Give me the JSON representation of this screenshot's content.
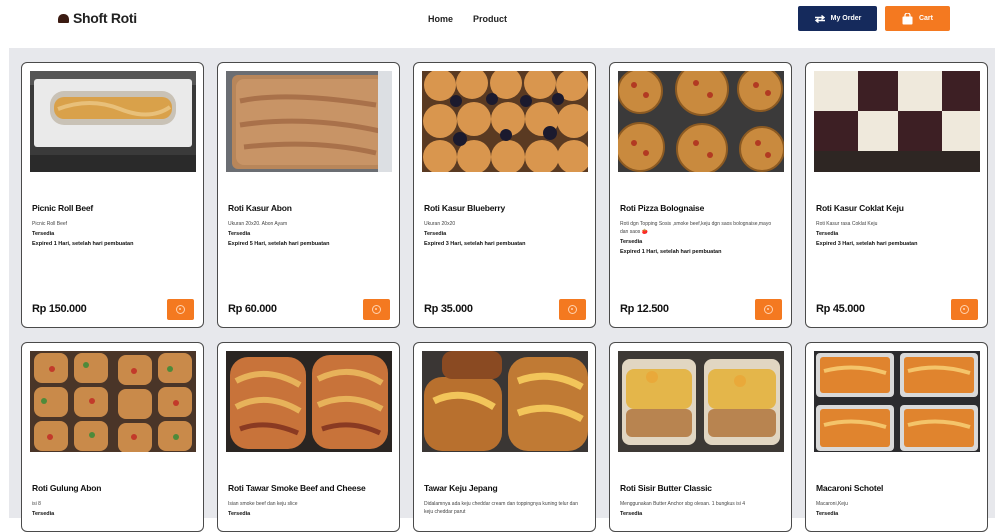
{
  "brand": {
    "name": "Shoft Roti",
    "icon": "bread-icon"
  },
  "nav": {
    "links": [
      "Home",
      "Product"
    ]
  },
  "actions": {
    "order_label": "My Order",
    "cart_label": "Cart"
  },
  "colors": {
    "primary": "#152a5c",
    "accent": "#f47920",
    "background": "#e7e8ec"
  },
  "products": [
    {
      "name": "Picnic Roll Beef",
      "desc": "Picnic Roll Beef",
      "status": "Tersedia",
      "expiry": "Expired 1 Hari, setelah hari pembuatan",
      "price": "Rp 150.000"
    },
    {
      "name": "Roti Kasur Abon",
      "desc": "Ukuran 20x20. Abon Ayam",
      "status": "Tersedia",
      "expiry": "Expired 5 Hari, setelah hari pembuatan",
      "price": "Rp 60.000"
    },
    {
      "name": "Roti Kasur Blueberry",
      "desc": "Ukuran 20x20",
      "status": "Tersedia",
      "expiry": "Expired 3 Hari, setelah hari pembuatan",
      "price": "Rp 35.000"
    },
    {
      "name": "Roti Pizza Bolognaise",
      "desc": "Roti dgn Topping Sosis ,smoke beef,keju dgn saos bolognaise,mayo dan saos 🍅",
      "status": "Tersedia",
      "expiry": "Expired 1 Hari, setelah hari pembuatan",
      "price": "Rp 12.500"
    },
    {
      "name": "Roti Kasur Coklat Keju",
      "desc": "Roti Kasur rasa Coklat Keju",
      "status": "Tersedia",
      "expiry": "Expired 3 Hari, setelah hari pembuatan",
      "price": "Rp 45.000"
    },
    {
      "name": "Roti Gulung Abon",
      "desc": "isi 8",
      "status": "Tersedia",
      "expiry": "",
      "price": ""
    },
    {
      "name": "Roti Tawar Smoke Beef and Cheese",
      "desc": "Isian smoke beef dan keju slice",
      "status": "Tersedia",
      "expiry": "",
      "price": ""
    },
    {
      "name": "Tawar Keju Jepang",
      "desc": "Didalamnya ada keju cheddar cream dan toppingnya kuning telur dan keju cheddar parut",
      "status": "",
      "expiry": "",
      "price": ""
    },
    {
      "name": "Roti Sisir Butter Classic",
      "desc": "Menggunakan Butter Anchor sbg olesan. 1 bungkus isi 4",
      "status": "Tersedia",
      "expiry": "",
      "price": ""
    },
    {
      "name": "Macaroni Schotel",
      "desc": "Macaroni,Keju",
      "status": "Tersedia",
      "expiry": "",
      "price": ""
    }
  ]
}
